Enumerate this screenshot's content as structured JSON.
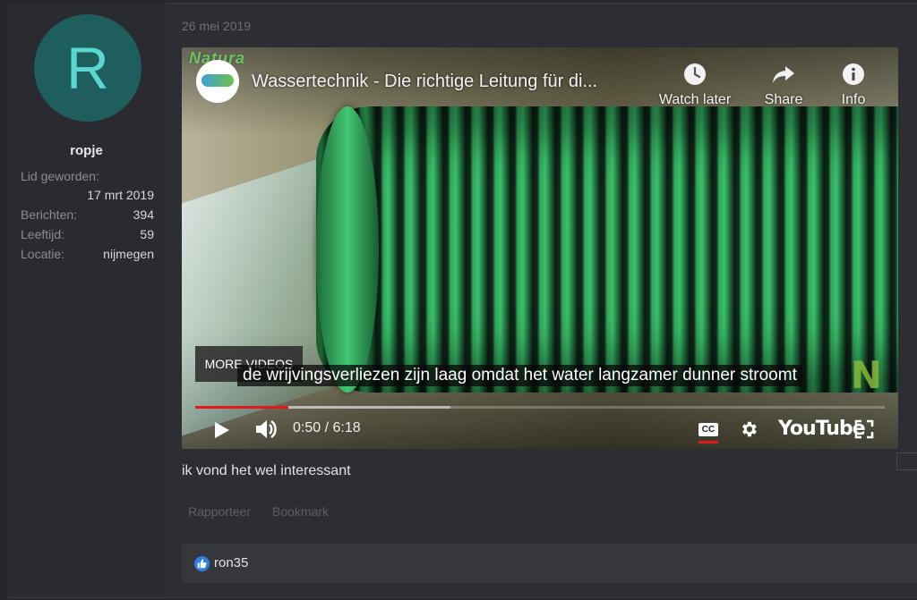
{
  "author": {
    "avatar_letter": "R",
    "username": "ropje",
    "stats": [
      {
        "label": "Lid geworden:",
        "value": "17 mrt 2019"
      },
      {
        "label": "Berichten:",
        "value": "394"
      },
      {
        "label": "Leeftijd:",
        "value": "59"
      },
      {
        "label": "Locatie:",
        "value": "nijmegen"
      }
    ]
  },
  "post": {
    "date": "26 mei 2019",
    "message": "ik vond het wel interessant",
    "actions": {
      "report": "Rapporteer",
      "bookmark": "Bookmark"
    },
    "reactions": {
      "user": "ron35",
      "icon": "thumbs-up-icon"
    }
  },
  "video": {
    "channel_mark": "Natura",
    "title": "Wassertechnik - Die richtige Leitung für di...",
    "top_actions": {
      "watch_later": "Watch later",
      "share": "Share",
      "info": "Info"
    },
    "more_videos": "MORE VIDEOS",
    "caption": "de wrijvingsverliezen zijn laag omdat het water langzamer dunner stroomt",
    "time": "0:50 / 6:18",
    "played_fraction": 0.135,
    "buffered_fraction": 0.37,
    "cc_label": "CC",
    "brand": "YouTube",
    "watermark": "N"
  },
  "colors": {
    "accent_red": "#e01a1a",
    "avatar_bg": "#1e5e5c",
    "avatar_fg": "#5ad8cf",
    "like_blue": "#2f7fe0"
  }
}
